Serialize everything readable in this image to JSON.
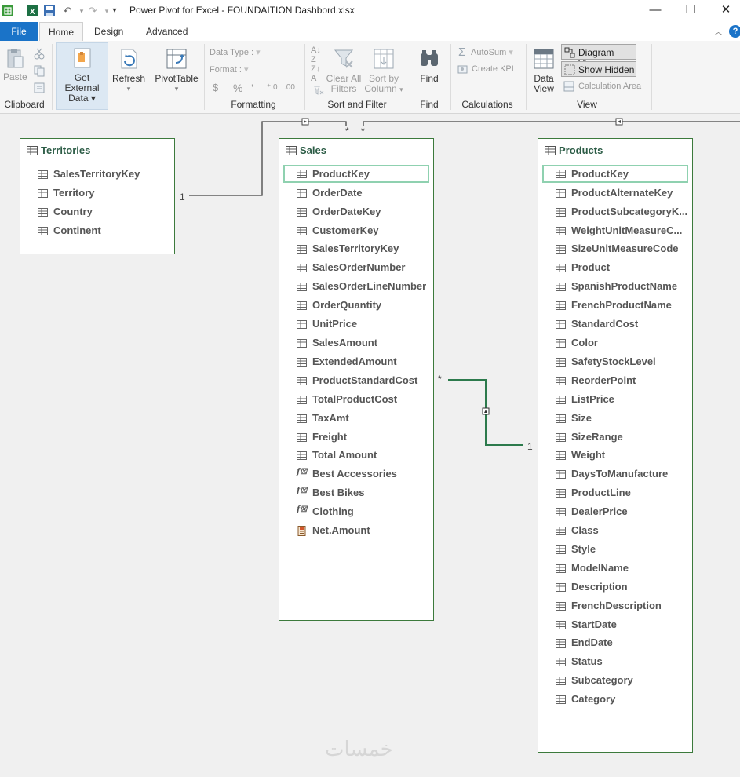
{
  "title": "Power Pivot for Excel - FOUNDAITION Dashbord.xlsx",
  "tabs": {
    "file": "File",
    "home": "Home",
    "design": "Design",
    "advanced": "Advanced"
  },
  "ribbon": {
    "clipboard": {
      "paste": "Paste",
      "group": "Clipboard"
    },
    "get_external": {
      "line1": "Get External",
      "line2": "Data"
    },
    "refresh": "Refresh",
    "pivottable": "PivotTable",
    "formatting": {
      "data_type": "Data Type :",
      "format": "Format :",
      "currency": "$",
      "percent": "%",
      "comma": "’",
      "group": "Formatting"
    },
    "sort_filter": {
      "clear_l1": "Clear All",
      "clear_l2": "Filters",
      "sortby_l1": "Sort by",
      "sortby_l2": "Column",
      "group": "Sort and Filter"
    },
    "find": {
      "label": "Find",
      "group": "Find"
    },
    "calculations": {
      "autosum": "AutoSum",
      "create_kpi": "Create KPI",
      "group": "Calculations"
    },
    "view": {
      "data_view_l1": "Data",
      "data_view_l2": "View",
      "diagram_view": "Diagram View",
      "show_hidden": "Show Hidden",
      "calc_area": "Calculation Area",
      "group": "View"
    }
  },
  "tables": {
    "territories": {
      "name": "Territories",
      "columns": [
        "SalesTerritoryKey",
        "Territory",
        "Country",
        "Continent"
      ]
    },
    "sales": {
      "name": "Sales",
      "columns": [
        "ProductKey",
        "OrderDate",
        "OrderDateKey",
        "CustomerKey",
        "SalesTerritoryKey",
        "SalesOrderNumber",
        "SalesOrderLineNumber",
        "OrderQuantity",
        "UnitPrice",
        "SalesAmount",
        "ExtendedAmount",
        "ProductStandardCost",
        "TotalProductCost",
        "TaxAmt",
        "Freight",
        "Total Amount",
        "Best Accessories",
        "Best Bikes",
        "Clothing",
        "Net.Amount"
      ]
    },
    "products": {
      "name": "Products",
      "columns": [
        "ProductKey",
        "ProductAlternateKey",
        "ProductSubcategoryK...",
        "WeightUnitMeasureC...",
        "SizeUnitMeasureCode",
        "Product",
        "SpanishProductName",
        "FrenchProductName",
        "StandardCost",
        "Color",
        "SafetyStockLevel",
        "ReorderPoint",
        "ListPrice",
        "Size",
        "SizeRange",
        "Weight",
        "DaysToManufacture",
        "ProductLine",
        "DealerPrice",
        "Class",
        "Style",
        "ModelName",
        "Description",
        "FrenchDescription",
        "StartDate",
        "EndDate",
        "Status",
        "Subcategory",
        "Category"
      ]
    }
  },
  "relationships": {
    "one": "1",
    "many": "*"
  },
  "watermark": "خمسات"
}
